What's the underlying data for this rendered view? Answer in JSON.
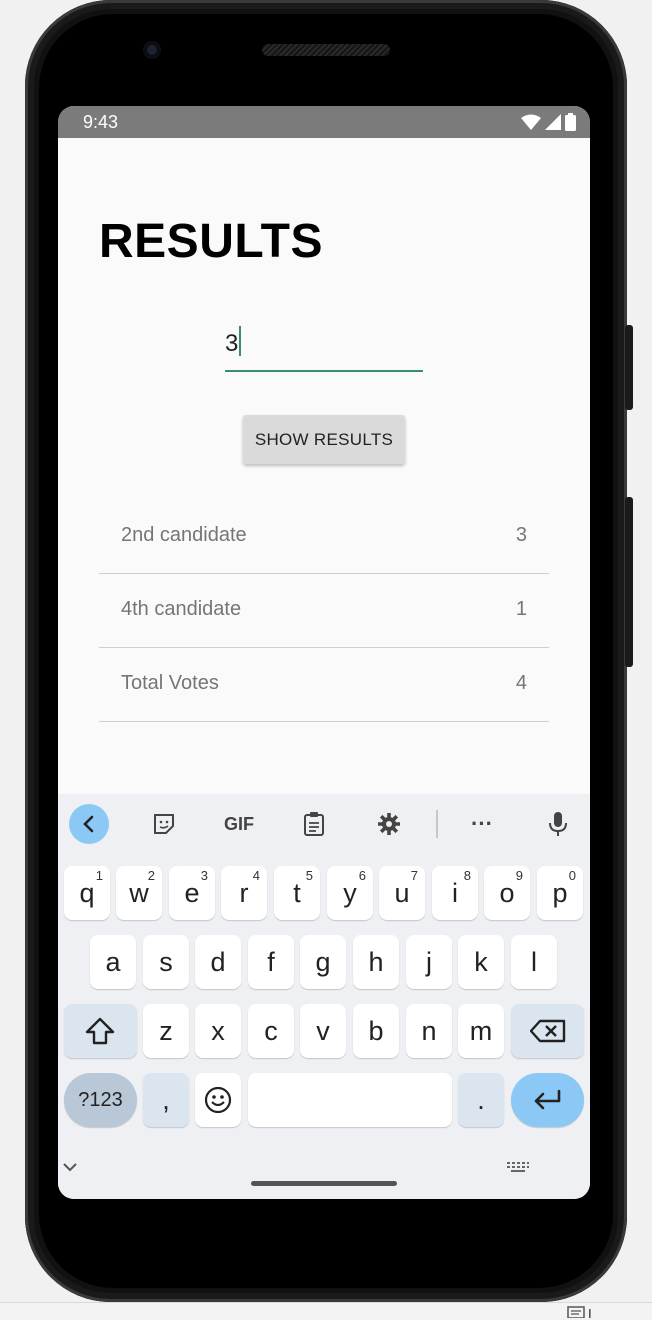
{
  "status_bar": {
    "time": "9:43"
  },
  "page": {
    "title": "RESULTS"
  },
  "input": {
    "value": "3"
  },
  "show_button": {
    "label": "SHOW RESULTS"
  },
  "results": [
    {
      "label": "2nd candidate",
      "value": "3"
    },
    {
      "label": "4th candidate",
      "value": "1"
    },
    {
      "label": "Total Votes",
      "value": "4"
    }
  ],
  "keyboard": {
    "toolbar": {
      "gif_label": "GIF",
      "more_label": "···"
    },
    "row1": [
      {
        "key": "q",
        "hint": "1"
      },
      {
        "key": "w",
        "hint": "2"
      },
      {
        "key": "e",
        "hint": "3"
      },
      {
        "key": "r",
        "hint": "4"
      },
      {
        "key": "t",
        "hint": "5"
      },
      {
        "key": "y",
        "hint": "6"
      },
      {
        "key": "u",
        "hint": "7"
      },
      {
        "key": "i",
        "hint": "8"
      },
      {
        "key": "o",
        "hint": "9"
      },
      {
        "key": "p",
        "hint": "0"
      }
    ],
    "row2": [
      "a",
      "s",
      "d",
      "f",
      "g",
      "h",
      "j",
      "k",
      "l"
    ],
    "row3": [
      "z",
      "x",
      "c",
      "v",
      "b",
      "n",
      "m"
    ],
    "symbols_label": "?123",
    "comma_label": ",",
    "period_label": ".",
    "colors": {
      "accent": "#8cc8f5",
      "function_key": "#dbe5ef",
      "symbols_key": "#b9c8d6"
    }
  }
}
